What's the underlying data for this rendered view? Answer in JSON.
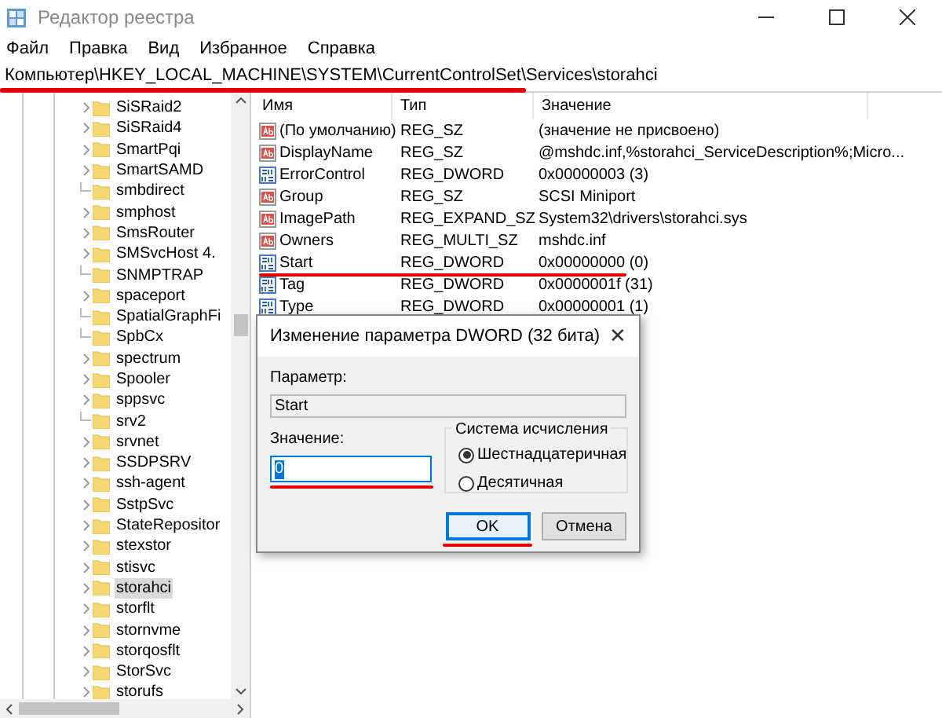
{
  "window": {
    "title": "Редактор реестра"
  },
  "menu": [
    "Файл",
    "Правка",
    "Вид",
    "Избранное",
    "Справка"
  ],
  "address": "Компьютер\\HKEY_LOCAL_MACHINE\\SYSTEM\\CurrentControlSet\\Services\\storahci",
  "tree": [
    {
      "label": "SiSRaid2",
      "expandable": true,
      "selected": false
    },
    {
      "label": "SiSRaid4",
      "expandable": true,
      "selected": false
    },
    {
      "label": "SmartPqi",
      "expandable": true,
      "selected": false
    },
    {
      "label": "SmartSAMD",
      "expandable": true,
      "selected": false
    },
    {
      "label": "smbdirect",
      "expandable": false,
      "selected": false
    },
    {
      "label": "smphost",
      "expandable": true,
      "selected": false
    },
    {
      "label": "SmsRouter",
      "expandable": true,
      "selected": false
    },
    {
      "label": "SMSvcHost 4.",
      "expandable": true,
      "selected": false
    },
    {
      "label": "SNMPTRAP",
      "expandable": false,
      "selected": false
    },
    {
      "label": "spaceport",
      "expandable": true,
      "selected": false
    },
    {
      "label": "SpatialGraphFi",
      "expandable": false,
      "selected": false
    },
    {
      "label": "SpbCx",
      "expandable": false,
      "selected": false
    },
    {
      "label": "spectrum",
      "expandable": true,
      "selected": false
    },
    {
      "label": "Spooler",
      "expandable": true,
      "selected": false
    },
    {
      "label": "sppsvc",
      "expandable": true,
      "selected": false
    },
    {
      "label": "srv2",
      "expandable": false,
      "selected": false
    },
    {
      "label": "srvnet",
      "expandable": true,
      "selected": false
    },
    {
      "label": "SSDPSRV",
      "expandable": true,
      "selected": false
    },
    {
      "label": "ssh-agent",
      "expandable": true,
      "selected": false
    },
    {
      "label": "SstpSvc",
      "expandable": true,
      "selected": false
    },
    {
      "label": "StateRepositor",
      "expandable": true,
      "selected": false
    },
    {
      "label": "stexstor",
      "expandable": true,
      "selected": false
    },
    {
      "label": "stisvc",
      "expandable": true,
      "selected": false
    },
    {
      "label": "storahci",
      "expandable": true,
      "selected": true
    },
    {
      "label": "storflt",
      "expandable": true,
      "selected": false
    },
    {
      "label": "stornvme",
      "expandable": true,
      "selected": false
    },
    {
      "label": "storqosflt",
      "expandable": true,
      "selected": false
    },
    {
      "label": "StorSvc",
      "expandable": true,
      "selected": false
    },
    {
      "label": "storufs",
      "expandable": true,
      "selected": false
    }
  ],
  "table": {
    "columns": [
      "Имя",
      "Тип",
      "Значение"
    ],
    "rows": [
      {
        "kind": "string",
        "name": "(По умолчанию)",
        "type": "REG_SZ",
        "value": "(значение не присвоено)"
      },
      {
        "kind": "string",
        "name": "DisplayName",
        "type": "REG_SZ",
        "value": "@mshdc.inf,%storahci_ServiceDescription%;Micro..."
      },
      {
        "kind": "binary",
        "name": "ErrorControl",
        "type": "REG_DWORD",
        "value": "0x00000003 (3)"
      },
      {
        "kind": "string",
        "name": "Group",
        "type": "REG_SZ",
        "value": "SCSI Miniport"
      },
      {
        "kind": "string",
        "name": "ImagePath",
        "type": "REG_EXPAND_SZ",
        "value": "System32\\drivers\\storahci.sys"
      },
      {
        "kind": "string",
        "name": "Owners",
        "type": "REG_MULTI_SZ",
        "value": "mshdc.inf"
      },
      {
        "kind": "binary",
        "name": "Start",
        "type": "REG_DWORD",
        "value": "0x00000000 (0)"
      },
      {
        "kind": "binary",
        "name": "Tag",
        "type": "REG_DWORD",
        "value": "0x0000001f (31)"
      },
      {
        "kind": "binary",
        "name": "Type",
        "type": "REG_DWORD",
        "value": "0x00000001 (1)"
      }
    ]
  },
  "dialog": {
    "title": "Изменение параметра DWORD (32 бита)",
    "close": "✕",
    "parameter_label": "Параметр:",
    "parameter_value": "Start",
    "value_label": "Значение:",
    "value": "0",
    "base_group": "Система исчисления",
    "base_options": [
      {
        "label": "Шестнадцатеричная",
        "selected": true
      },
      {
        "label": "Десятичная",
        "selected": false
      }
    ],
    "buttons": [
      {
        "label": "OK",
        "default": true
      },
      {
        "label": "Отмена",
        "default": false
      }
    ]
  }
}
